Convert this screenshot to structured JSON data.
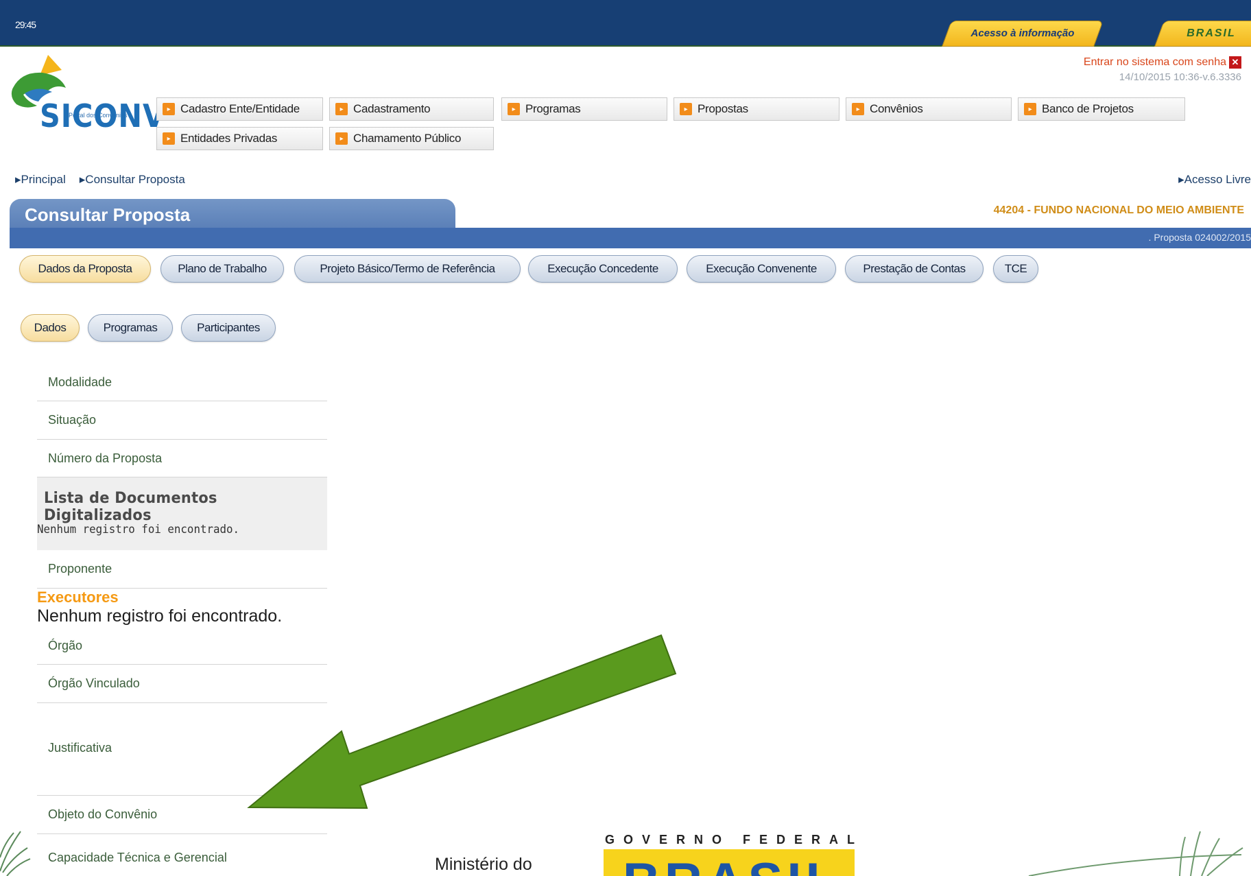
{
  "header": {
    "clock": "29:45",
    "acesso_tab": "Acesso à informação",
    "brasil_tab": "BRASIL",
    "login_link": "Entrar no sistema com senha",
    "timestamp": "14/10/2015 10:36-v.6.3336"
  },
  "logo": {
    "tagline": "Portal dos Convênios",
    "name": "SICONV"
  },
  "menu": [
    {
      "label": "Cadastro Ente/Entidade"
    },
    {
      "label": "Cadastramento"
    },
    {
      "label": "Programas"
    },
    {
      "label": "Propostas"
    },
    {
      "label": "Convênios"
    },
    {
      "label": "Banco de Projetos"
    },
    {
      "label": "Entidades Privadas"
    },
    {
      "label": "Chamamento Público"
    }
  ],
  "breadcrumb": {
    "items": [
      "Principal",
      "Consultar Proposta"
    ],
    "right": "Acesso Livre"
  },
  "page": {
    "title": "Consultar Proposta",
    "organ": "44204 - FUNDO NACIONAL DO MEIO AMBIENTE",
    "proposal_ref": "Proposta 024002/2015"
  },
  "main_tabs": [
    {
      "label": "Dados da Proposta",
      "active": true
    },
    {
      "label": "Plano de Trabalho"
    },
    {
      "label": "Projeto Básico/Termo de Referência"
    },
    {
      "label": "Execução Concedente"
    },
    {
      "label": "Execução Convenente"
    },
    {
      "label": "Prestação de Contas"
    },
    {
      "label": "TCE"
    }
  ],
  "sub_tabs": [
    {
      "label": "Dados",
      "active": true
    },
    {
      "label": "Programas"
    },
    {
      "label": "Participantes"
    }
  ],
  "fields": {
    "modalidade": "Modalidade",
    "situacao": "Situação",
    "numero": "Número da Proposta",
    "proponente": "Proponente",
    "orgao": "Órgão",
    "orgao_vinculado": "Órgão Vinculado",
    "justificativa": "Justificativa",
    "objeto": "Objeto do Convênio",
    "capacidade": "Capacidade Técnica e Gerencial"
  },
  "documents": {
    "title": "Lista de Documentos Digitalizados",
    "empty": "Nenhum registro foi encontrado."
  },
  "executores": {
    "title": "Executores",
    "empty": "Nenhum registro foi encontrado."
  },
  "footer": {
    "ministerio": "Ministério do",
    "gov_federal": "GOVERNO FEDERAL",
    "brasil": "BRASIL"
  },
  "colors": {
    "topbar": "#173f74",
    "accent_orange": "#f28c1a",
    "title_band": "#416cb0",
    "arrow": "#5a9a1e"
  }
}
